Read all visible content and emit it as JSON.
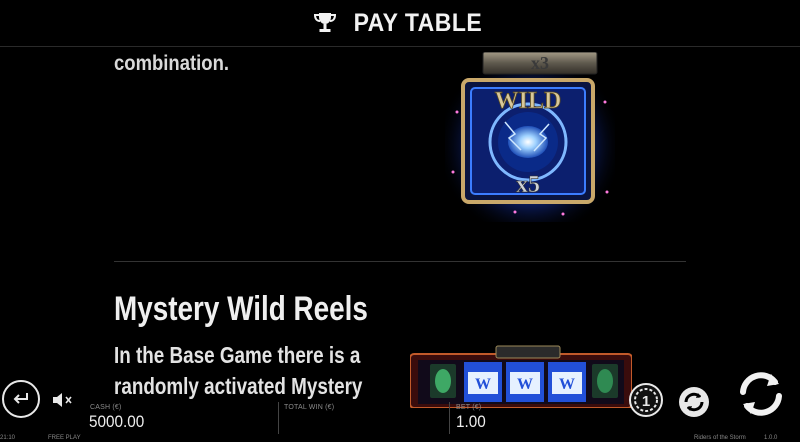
{
  "header": {
    "title": "PAY TABLE",
    "icon": "trophy-icon"
  },
  "paytable": {
    "prev_paragraph_tail": "combination.",
    "wild_symbol": {
      "top_multiplier": "x3",
      "label": "WILD",
      "bottom_multiplier": "x5"
    },
    "section_title": "Mystery Wild Reels",
    "section_lines": [
      "In the Base Game there is a",
      "randomly activated Mystery"
    ]
  },
  "meters": {
    "cash_label": "CASH (€)",
    "cash_value": "5000.00",
    "total_win_label": "TOTAL WIN (€)",
    "bet_label": "BET (€)",
    "bet_value": "1.00"
  },
  "controls": {
    "back": "back-arrow-icon",
    "sound": "speaker-muted-icon",
    "autoplay": "coin-one-icon",
    "autospin": "autoplay-icon",
    "spin": "spin-icon"
  },
  "footer": {
    "left_time": "21:10",
    "left_mode": "FREE PLAY",
    "right_game": "Riders of the Storm",
    "right_version": "1.0.0"
  },
  "colors": {
    "background": "#000000",
    "text": "#e9e9e9",
    "wild_glow": "#2f6bff"
  }
}
